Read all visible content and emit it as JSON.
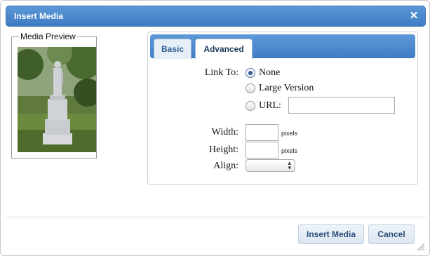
{
  "dialog": {
    "title": "Insert Media",
    "close_icon": "close-icon",
    "accent_color": "#3e7cc4"
  },
  "preview": {
    "legend": "Media Preview"
  },
  "tabs": [
    {
      "label": "Basic",
      "selected": false
    },
    {
      "label": "Advanced",
      "selected": true
    }
  ],
  "advanced": {
    "link_to_label": "Link To:",
    "link_options": [
      {
        "label": "None",
        "checked": true
      },
      {
        "label": "Large Version",
        "checked": false
      },
      {
        "label": "URL:",
        "checked": false
      }
    ],
    "url_value": "",
    "width_label": "Width:",
    "width_value": "",
    "width_unit": "pixels",
    "height_label": "Height:",
    "height_value": "",
    "height_unit": "pixels",
    "align_label": "Align:",
    "align_value": ""
  },
  "buttons": {
    "insert_label": "Insert Media",
    "cancel_label": "Cancel"
  }
}
